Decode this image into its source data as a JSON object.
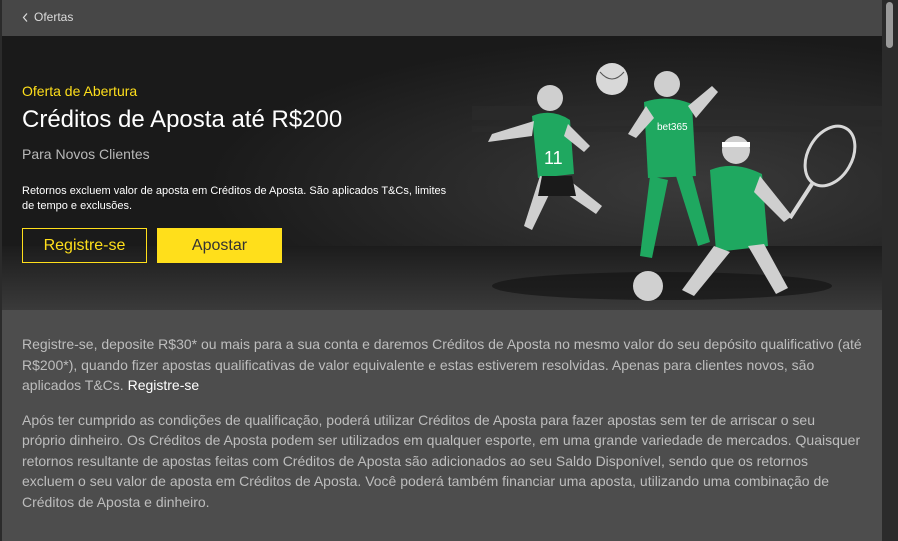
{
  "nav": {
    "back_label": "Ofertas"
  },
  "hero": {
    "kicker": "Oferta de Abertura",
    "title": "Créditos de Aposta até R$200",
    "subtitle": "Para Novos Clientes",
    "terms": "Retornos excluem valor de aposta em Créditos de Aposta. São aplicados T&Cs, limites de tempo e exclusões.",
    "register_label": "Registre-se",
    "bet_label": "Apostar",
    "jersey_logo": "bet365"
  },
  "content": {
    "p1_text": "Registre-se, deposite R$30* ou mais para a sua conta e daremos Créditos de Aposta no mesmo valor do seu depósito qualificativo (até R$200*), quando fizer apostas qualificativas de valor equivalente e estas estiverem resolvidas. Apenas para clientes novos, são aplicados T&Cs.",
    "p1_link": "Registre-se",
    "p2_text": "Após ter cumprido as condições de qualificação, poderá utilizar Créditos de Aposta para fazer apostas sem ter de arriscar o seu próprio dinheiro. Os Créditos de Aposta podem ser utilizados em qualquer esporte, em uma grande variedade de mercados. Quaisquer retornos resultante de apostas feitas com Créditos de Aposta são adicionados ao seu Saldo Disponível, sendo que os retornos excluem o seu valor de aposta em Créditos de Aposta. Você poderá também financiar uma aposta, utilizando uma combinação de Créditos de Aposta e dinheiro."
  },
  "colors": {
    "accent": "#ffdf1b",
    "page_bg": "#4d4d4d",
    "hero_bg": "#1d1d1d",
    "player_green": "#1fa860"
  },
  "icons": {
    "back": "chevron-left-icon"
  }
}
